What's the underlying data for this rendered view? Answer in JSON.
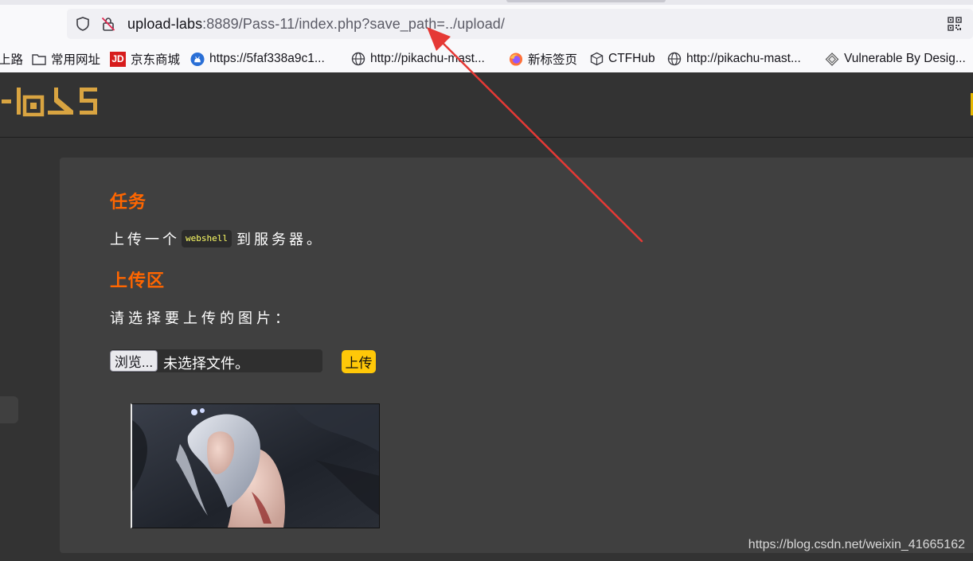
{
  "browser": {
    "url_host": "upload-labs",
    "url_rest": ":8889/Pass-11/index.php?save_path=../upload/",
    "bookmarks": [
      {
        "label": "上路",
        "icon": "text-only"
      },
      {
        "label": "常用网址",
        "icon": "folder-icon"
      },
      {
        "label": "京东商城",
        "icon": "jd-icon",
        "icon_text": "JD"
      },
      {
        "label": "https://5faf338a9c1...",
        "icon": "github-icon"
      },
      {
        "label": "http://pikachu-mast...",
        "icon": "globe-icon"
      },
      {
        "label": "新标签页",
        "icon": "firefox-icon"
      },
      {
        "label": "CTFHub",
        "icon": "cube-icon"
      },
      {
        "label": "http://pikachu-mast...",
        "icon": "globe-icon"
      },
      {
        "label": "Vulnerable By Desig...",
        "icon": "vulnhub-icon"
      }
    ]
  },
  "page": {
    "task_heading": "任务",
    "task_text_before": "上传一个",
    "task_code": "webshell",
    "task_text_after": "到服务器。",
    "upload_heading": "上传区",
    "upload_prompt": "请选择要上传的图片：",
    "browse_label": "浏览...",
    "file_status": "未选择文件。",
    "upload_label": "上传"
  },
  "watermark": "https://blog.csdn.net/weixin_41665162",
  "colors": {
    "page_bg": "#333333",
    "panel_bg": "#404040",
    "heading": "#ff6600",
    "logo": "#d9a441",
    "code_text": "#ffff66",
    "upload_button": "#ffc808",
    "annotation_arrow": "#e53935"
  }
}
